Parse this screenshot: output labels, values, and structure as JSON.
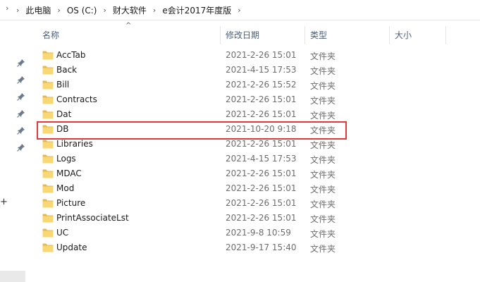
{
  "breadcrumb": {
    "items": [
      "此电脑",
      "OS (C:)",
      "财大软件",
      "e会计2017年度版"
    ]
  },
  "columns": {
    "name": "名称",
    "modified": "修改日期",
    "type": "类型",
    "size": "大小"
  },
  "files": [
    {
      "name": "AccTab",
      "modified": "2021-2-26 15:01",
      "type": "文件夹"
    },
    {
      "name": "Back",
      "modified": "2021-4-15 17:53",
      "type": "文件夹"
    },
    {
      "name": "Bill",
      "modified": "2021-2-26 15:52",
      "type": "文件夹"
    },
    {
      "name": "Contracts",
      "modified": "2021-2-26 15:01",
      "type": "文件夹"
    },
    {
      "name": "Dat",
      "modified": "2021-2-26 15:01",
      "type": "文件夹"
    },
    {
      "name": "DB",
      "modified": "2021-10-20 9:18",
      "type": "文件夹"
    },
    {
      "name": "Libraries",
      "modified": "2021-2-26 15:01",
      "type": "文件夹"
    },
    {
      "name": "Logs",
      "modified": "2021-4-15 17:53",
      "type": "文件夹"
    },
    {
      "name": "MDAC",
      "modified": "2021-2-26 15:01",
      "type": "文件夹"
    },
    {
      "name": "Mod",
      "modified": "2021-2-26 15:01",
      "type": "文件夹"
    },
    {
      "name": "Picture",
      "modified": "2021-2-26 15:01",
      "type": "文件夹"
    },
    {
      "name": "PrintAssociateLst",
      "modified": "2021-2-26 15:01",
      "type": "文件夹"
    },
    {
      "name": "UC",
      "modified": "2021-9-8 10:59",
      "type": "文件夹"
    },
    {
      "name": "Update",
      "modified": "2021-9-17 15:40",
      "type": "文件夹"
    }
  ],
  "highlight_row": "DB",
  "colors": {
    "folder": "#f8d775",
    "folder_dark": "#e8b84a",
    "highlight_border": "#e23a3a",
    "header_text": "#4c607a"
  },
  "icons": {
    "pin": "pin-icon",
    "folder": "folder-icon",
    "sort": "sort-up-icon"
  }
}
